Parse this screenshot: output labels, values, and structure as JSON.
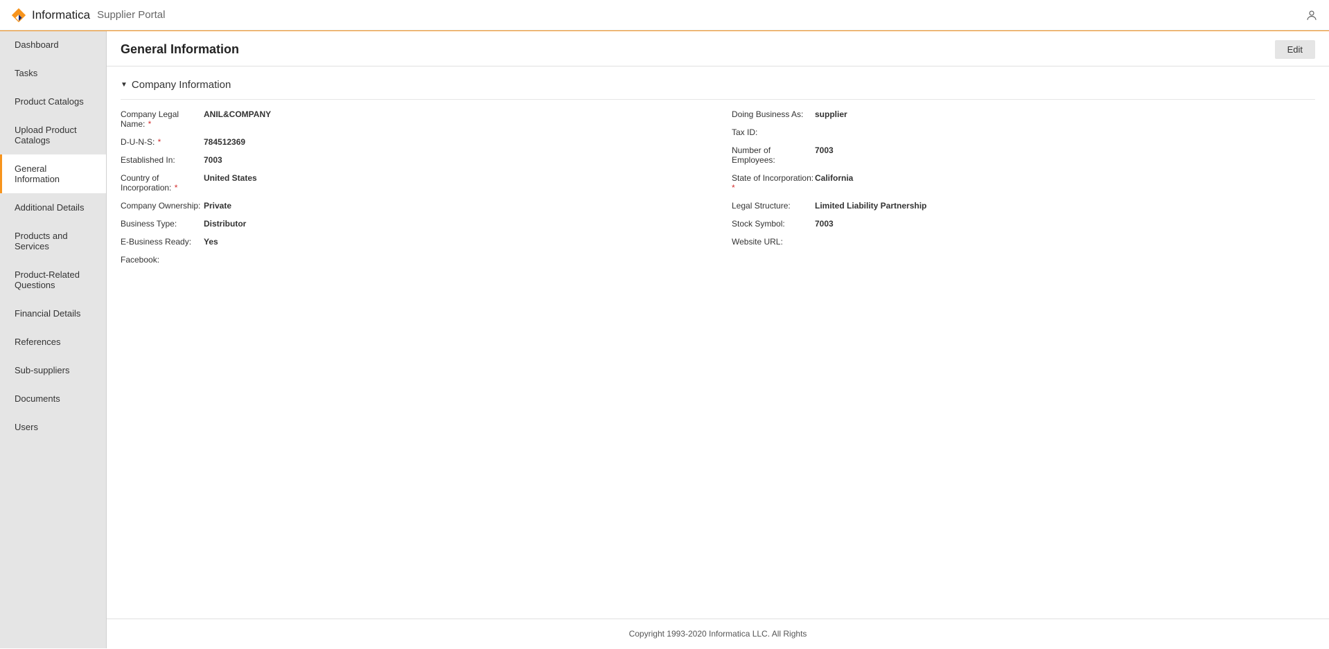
{
  "brand": "Informatica",
  "portal": "Supplier Portal",
  "sidebar": {
    "items": [
      {
        "label": "Dashboard",
        "active": false
      },
      {
        "label": "Tasks",
        "active": false
      },
      {
        "label": "Product Catalogs",
        "active": false
      },
      {
        "label": "Upload Product Catalogs",
        "active": false
      },
      {
        "label": "General Information",
        "active": true
      },
      {
        "label": "Additional Details",
        "active": false
      },
      {
        "label": "Products and Services",
        "active": false
      },
      {
        "label": "Product-Related Questions",
        "active": false
      },
      {
        "label": "Financial Details",
        "active": false
      },
      {
        "label": "References",
        "active": false
      },
      {
        "label": "Sub-suppliers",
        "active": false
      },
      {
        "label": "Documents",
        "active": false
      },
      {
        "label": "Users",
        "active": false
      }
    ]
  },
  "page": {
    "title": "General Information",
    "edit_label": "Edit"
  },
  "section": {
    "title": "Company Information"
  },
  "fields_left": [
    {
      "label": "Company Legal Name:",
      "required": true,
      "value": "ANIL&COMPANY"
    },
    {
      "label": "D-U-N-S:",
      "required": true,
      "value": "784512369"
    },
    {
      "label": "Established In:",
      "required": false,
      "value": "7003"
    },
    {
      "label": "Country of Incorporation:",
      "required": true,
      "value": "United States"
    },
    {
      "label": "Company Ownership:",
      "required": false,
      "value": "Private"
    },
    {
      "label": "Business Type:",
      "required": false,
      "value": "Distributor"
    },
    {
      "label": "E-Business Ready:",
      "required": false,
      "value": "Yes"
    },
    {
      "label": "Facebook:",
      "required": false,
      "value": ""
    }
  ],
  "fields_right": [
    {
      "label": "Doing Business As:",
      "required": false,
      "value": "supplier"
    },
    {
      "label": "Tax ID:",
      "required": false,
      "value": ""
    },
    {
      "label": "Number of Employees:",
      "required": false,
      "value": "7003"
    },
    {
      "label": "State of Incorporation:",
      "required": true,
      "value": "California"
    },
    {
      "label": "Legal Structure:",
      "required": false,
      "value": "Limited Liability Partnership"
    },
    {
      "label": "Stock Symbol:",
      "required": false,
      "value": "7003"
    },
    {
      "label": "Website URL:",
      "required": false,
      "value": ""
    }
  ],
  "footer": "Copyright 1993-2020 Informatica LLC. All Rights"
}
